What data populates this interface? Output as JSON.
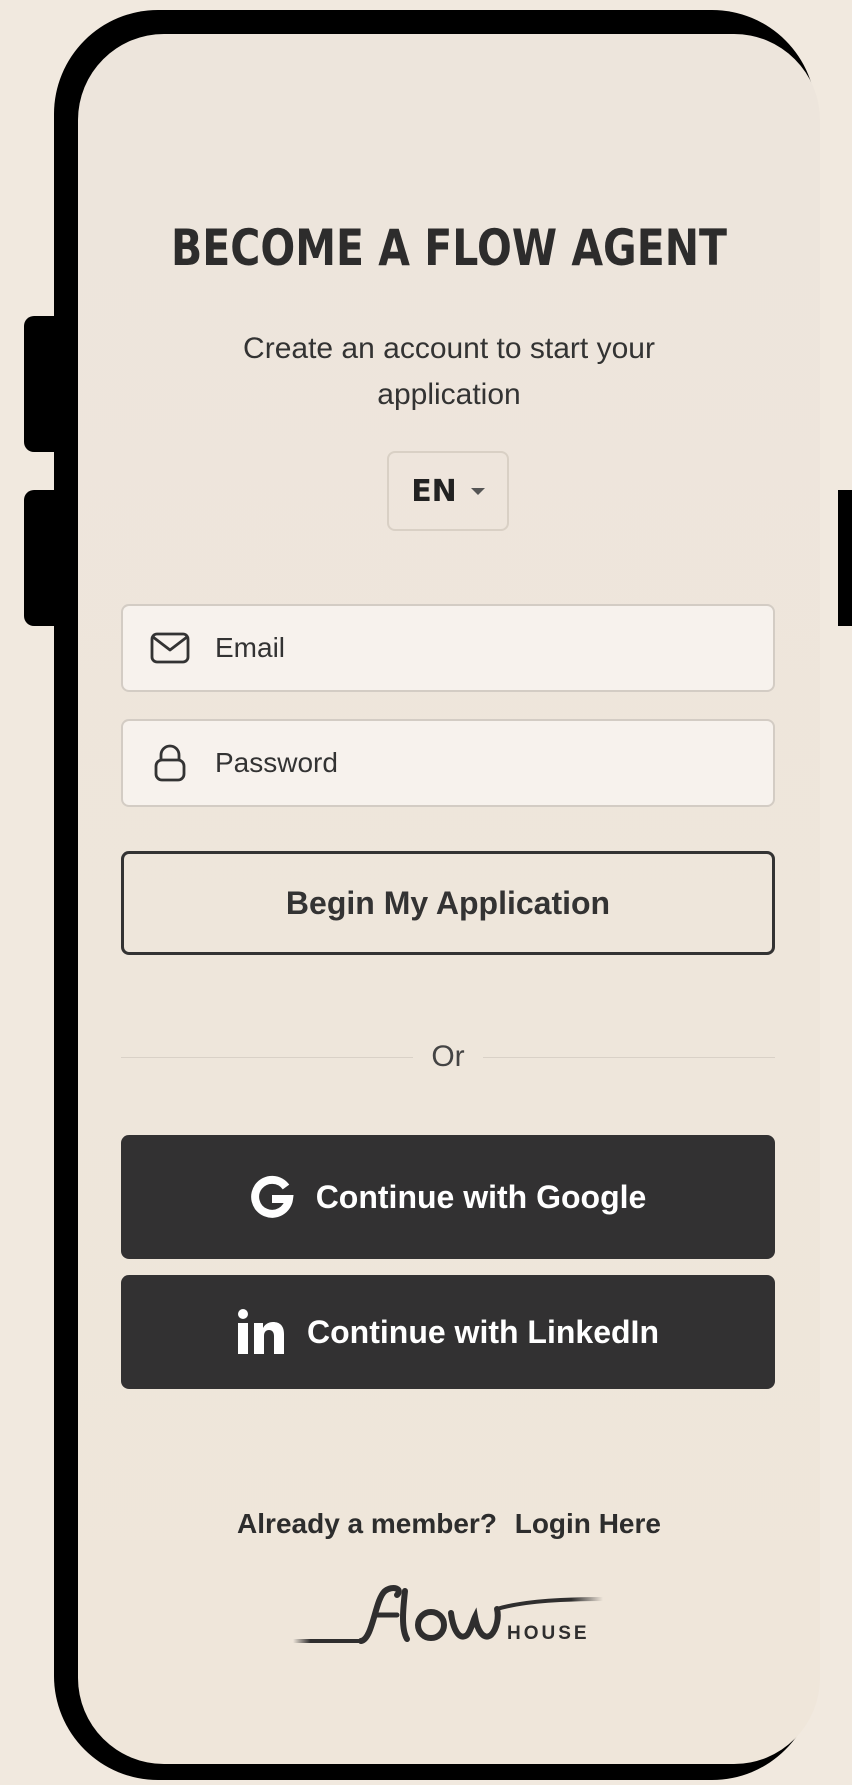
{
  "header": {
    "title": "BECOME A FLOW AGENT",
    "subtitle": "Create an account to start your application"
  },
  "language": {
    "selected": "EN"
  },
  "form": {
    "email_placeholder": "Email",
    "password_placeholder": "Password",
    "submit_label": "Begin My Application"
  },
  "divider_label": "Or",
  "social": {
    "google_label": "Continue with Google",
    "linkedin_label": "Continue with LinkedIn"
  },
  "footer": {
    "member_text": "Already a member?",
    "login_link": "Login Here"
  },
  "brand": {
    "logo_script": "flow",
    "logo_sub": "HOUSE"
  },
  "icons": {
    "email": "envelope-icon",
    "password": "lock-icon",
    "google": "google-icon",
    "linkedin": "linkedin-icon",
    "lang": "caret-down-icon"
  },
  "colors": {
    "background": "#f1e9df",
    "screen": "#ede5dc",
    "dark_button": "#323132",
    "text": "#2d2c2c"
  }
}
